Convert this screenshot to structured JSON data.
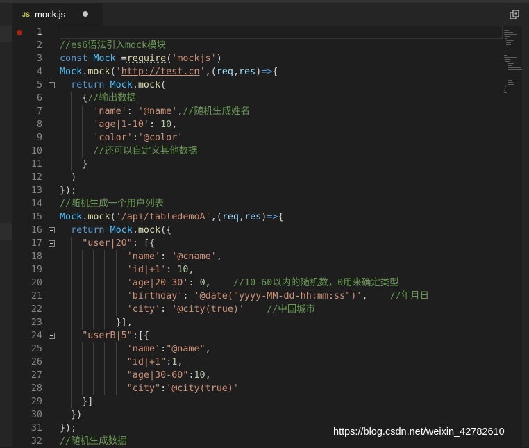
{
  "tab": {
    "icon_text": "JS",
    "file_name": "mock.js"
  },
  "watermark": "https://blog.csdn.net/weixin_42782610",
  "colors": {
    "comment": "#6a9955",
    "keyword": "#569cd6",
    "string": "#ce9178",
    "number": "#b5cea8",
    "function": "#dcdcaa",
    "parameter": "#9cdcfe",
    "variable": "#4fc1ff"
  },
  "lines": [
    {
      "n": "1",
      "segs": []
    },
    {
      "n": "2",
      "segs": [
        {
          "t": "//es6语法引入mock模块",
          "c": "com"
        }
      ]
    },
    {
      "n": "3",
      "segs": [
        {
          "t": "const ",
          "c": "kw"
        },
        {
          "t": "Mock",
          "c": "var"
        },
        {
          "t": " =",
          "c": "pun"
        },
        {
          "t": "require",
          "c": "fn"
        },
        {
          "t": "(",
          "c": "pun"
        },
        {
          "t": "'mockjs'",
          "c": "str"
        },
        {
          "t": ")",
          "c": "pun"
        }
      ]
    },
    {
      "n": "4",
      "segs": [
        {
          "t": "Mock",
          "c": "var"
        },
        {
          "t": ".",
          "c": "pun"
        },
        {
          "t": "mock",
          "c": "fn"
        },
        {
          "t": "(",
          "c": "pun"
        },
        {
          "t": "'",
          "c": "str"
        },
        {
          "t": "http://test.cn",
          "c": "str link"
        },
        {
          "t": "'",
          "c": "str"
        },
        {
          "t": ",(",
          "c": "pun"
        },
        {
          "t": "req",
          "c": "par"
        },
        {
          "t": ",",
          "c": "pun"
        },
        {
          "t": "res",
          "c": "par"
        },
        {
          "t": ")",
          "c": "pun"
        },
        {
          "t": "=>",
          "c": "kw"
        },
        {
          "t": "{",
          "c": "pun"
        }
      ]
    },
    {
      "n": "5",
      "segs": [
        {
          "t": "  ",
          "c": "pun"
        },
        {
          "t": "return ",
          "c": "kw"
        },
        {
          "t": "Mock",
          "c": "var"
        },
        {
          "t": ".",
          "c": "pun"
        },
        {
          "t": "mock",
          "c": "fn"
        },
        {
          "t": "(",
          "c": "pun"
        }
      ]
    },
    {
      "n": "6",
      "segs": [
        {
          "t": "    {",
          "c": "pun"
        },
        {
          "t": "//输出数据",
          "c": "com"
        }
      ]
    },
    {
      "n": "7",
      "segs": [
        {
          "t": "      ",
          "c": "pun"
        },
        {
          "t": "'name'",
          "c": "str"
        },
        {
          "t": ": ",
          "c": "pun"
        },
        {
          "t": "'@name'",
          "c": "str"
        },
        {
          "t": ",",
          "c": "pun"
        },
        {
          "t": "//随机生成姓名",
          "c": "com"
        }
      ]
    },
    {
      "n": "8",
      "segs": [
        {
          "t": "      ",
          "c": "pun"
        },
        {
          "t": "'age|1-10'",
          "c": "str"
        },
        {
          "t": ": ",
          "c": "pun"
        },
        {
          "t": "10",
          "c": "num"
        },
        {
          "t": ",",
          "c": "pun"
        }
      ]
    },
    {
      "n": "9",
      "segs": [
        {
          "t": "      ",
          "c": "pun"
        },
        {
          "t": "'color'",
          "c": "str"
        },
        {
          "t": ":",
          "c": "pun"
        },
        {
          "t": "'@color'",
          "c": "str"
        }
      ]
    },
    {
      "n": "10",
      "segs": [
        {
          "t": "      ",
          "c": "pun"
        },
        {
          "t": "//还可以自定义其他数据",
          "c": "com"
        }
      ]
    },
    {
      "n": "11",
      "segs": [
        {
          "t": "    }",
          "c": "pun"
        }
      ]
    },
    {
      "n": "12",
      "segs": [
        {
          "t": "  )",
          "c": "pun"
        }
      ]
    },
    {
      "n": "13",
      "segs": [
        {
          "t": "});",
          "c": "pun"
        }
      ]
    },
    {
      "n": "14",
      "segs": [
        {
          "t": "//随机生成一个用户列表",
          "c": "com"
        }
      ]
    },
    {
      "n": "15",
      "segs": [
        {
          "t": "Mock",
          "c": "var"
        },
        {
          "t": ".",
          "c": "pun"
        },
        {
          "t": "mock",
          "c": "fn"
        },
        {
          "t": "(",
          "c": "pun"
        },
        {
          "t": "'/api/tabledemoA'",
          "c": "str"
        },
        {
          "t": ",(",
          "c": "pun"
        },
        {
          "t": "req",
          "c": "par"
        },
        {
          "t": ",",
          "c": "pun"
        },
        {
          "t": "res",
          "c": "par"
        },
        {
          "t": ")",
          "c": "pun"
        },
        {
          "t": "=>",
          "c": "kw"
        },
        {
          "t": "{",
          "c": "pun"
        }
      ]
    },
    {
      "n": "16",
      "segs": [
        {
          "t": "  ",
          "c": "pun"
        },
        {
          "t": "return ",
          "c": "kw"
        },
        {
          "t": "Mock",
          "c": "var"
        },
        {
          "t": ".",
          "c": "pun"
        },
        {
          "t": "mock",
          "c": "fn"
        },
        {
          "t": "({",
          "c": "pun"
        }
      ]
    },
    {
      "n": "17",
      "segs": [
        {
          "t": "    ",
          "c": "pun"
        },
        {
          "t": "\"user|20\"",
          "c": "str"
        },
        {
          "t": ": [{",
          "c": "pun"
        }
      ]
    },
    {
      "n": "18",
      "segs": [
        {
          "t": "            ",
          "c": "pun"
        },
        {
          "t": "'name'",
          "c": "str"
        },
        {
          "t": ": ",
          "c": "pun"
        },
        {
          "t": "'@cname'",
          "c": "str"
        },
        {
          "t": ",",
          "c": "pun"
        }
      ]
    },
    {
      "n": "19",
      "segs": [
        {
          "t": "            ",
          "c": "pun"
        },
        {
          "t": "'id|+1'",
          "c": "str"
        },
        {
          "t": ": ",
          "c": "pun"
        },
        {
          "t": "10",
          "c": "num"
        },
        {
          "t": ",",
          "c": "pun"
        }
      ]
    },
    {
      "n": "20",
      "segs": [
        {
          "t": "            ",
          "c": "pun"
        },
        {
          "t": "'age|20-30'",
          "c": "str"
        },
        {
          "t": ": ",
          "c": "pun"
        },
        {
          "t": "0",
          "c": "num"
        },
        {
          "t": ",    ",
          "c": "pun"
        },
        {
          "t": "//10-60以内的随机数，0用来确定类型",
          "c": "com"
        }
      ]
    },
    {
      "n": "21",
      "segs": [
        {
          "t": "            ",
          "c": "pun"
        },
        {
          "t": "'birthday'",
          "c": "str"
        },
        {
          "t": ": ",
          "c": "pun"
        },
        {
          "t": "'@date(\"yyyy-MM-dd-hh:mm:ss\")'",
          "c": "str"
        },
        {
          "t": ",    ",
          "c": "pun"
        },
        {
          "t": "//年月日",
          "c": "com"
        }
      ]
    },
    {
      "n": "22",
      "segs": [
        {
          "t": "            ",
          "c": "pun"
        },
        {
          "t": "'city'",
          "c": "str"
        },
        {
          "t": ": ",
          "c": "pun"
        },
        {
          "t": "'@city(true)'",
          "c": "str"
        },
        {
          "t": "    ",
          "c": "pun"
        },
        {
          "t": "//中国城市",
          "c": "com"
        }
      ]
    },
    {
      "n": "23",
      "segs": [
        {
          "t": "          }],",
          "c": "pun"
        }
      ]
    },
    {
      "n": "24",
      "segs": [
        {
          "t": "    ",
          "c": "pun"
        },
        {
          "t": "\"userB|5\"",
          "c": "str"
        },
        {
          "t": ":[{",
          "c": "pun"
        }
      ]
    },
    {
      "n": "25",
      "segs": [
        {
          "t": "            ",
          "c": "pun"
        },
        {
          "t": "'name'",
          "c": "str"
        },
        {
          "t": ":",
          "c": "pun"
        },
        {
          "t": "\"@name\"",
          "c": "str"
        },
        {
          "t": ",",
          "c": "pun"
        }
      ]
    },
    {
      "n": "26",
      "segs": [
        {
          "t": "            ",
          "c": "pun"
        },
        {
          "t": "\"id|+1\"",
          "c": "str"
        },
        {
          "t": ":",
          "c": "pun"
        },
        {
          "t": "1",
          "c": "num"
        },
        {
          "t": ",",
          "c": "pun"
        }
      ]
    },
    {
      "n": "27",
      "segs": [
        {
          "t": "            ",
          "c": "pun"
        },
        {
          "t": "\"age|30-60\"",
          "c": "str"
        },
        {
          "t": ":",
          "c": "pun"
        },
        {
          "t": "10",
          "c": "num"
        },
        {
          "t": ",",
          "c": "pun"
        }
      ]
    },
    {
      "n": "28",
      "segs": [
        {
          "t": "            ",
          "c": "pun"
        },
        {
          "t": "\"city\"",
          "c": "str"
        },
        {
          "t": ":",
          "c": "pun"
        },
        {
          "t": "'@city(true)'",
          "c": "str"
        }
      ]
    },
    {
      "n": "29",
      "segs": [
        {
          "t": "    }]",
          "c": "pun"
        }
      ]
    },
    {
      "n": "30",
      "segs": [
        {
          "t": "  })",
          "c": "pun"
        }
      ]
    },
    {
      "n": "31",
      "segs": [
        {
          "t": "});",
          "c": "pun"
        }
      ]
    },
    {
      "n": "32",
      "segs": [
        {
          "t": "//随机生成数据",
          "c": "com"
        }
      ]
    }
  ]
}
